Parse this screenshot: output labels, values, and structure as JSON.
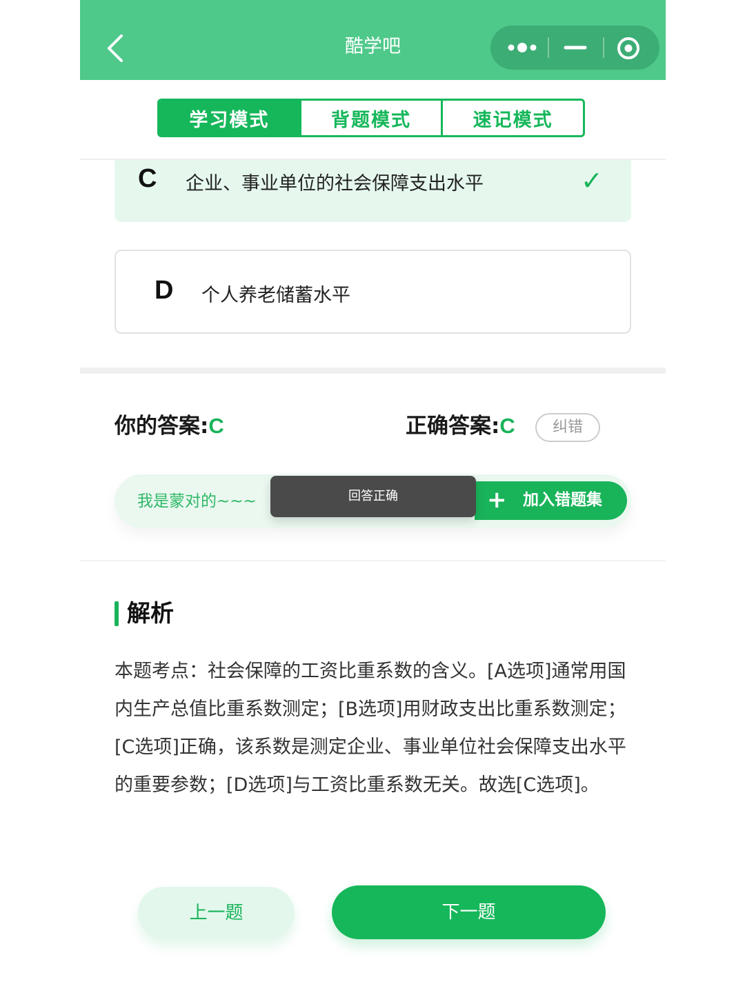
{
  "navbar": {
    "title": "酷学吧",
    "back_icon": "chevron-left-icon",
    "more_icon": "more-dots-icon",
    "minimize_icon": "minimize-icon",
    "close_icon": "target-close-icon"
  },
  "tabs": [
    {
      "label": "学习模式",
      "active": true
    },
    {
      "label": "背题模式",
      "active": false
    },
    {
      "label": "速记模式",
      "active": false
    }
  ],
  "options": {
    "c": {
      "letter": "C",
      "text": "企业、事业单位的社会保障支出水平",
      "mark": "✓"
    },
    "d": {
      "letter": "D",
      "text": "个人养老储蓄水平"
    }
  },
  "answer": {
    "your_label": "你的答案:",
    "your_value": "C",
    "correct_label": "正确答案:",
    "correct_value": "C",
    "report_label": "纠错"
  },
  "feedback": {
    "lucky_text": "我是蒙对的~~~",
    "toast": "回答正确",
    "add_plus": "+",
    "add_label": "加入错题集"
  },
  "analysis": {
    "title": "解析",
    "body": "本题考点：社会保障的工资比重系数的含义。[A选项]通常用国内生产总值比重系数测定；[B选项]用财政支出比重系数测定；[C选项]正确，该系数是测定企业、事业单位社会保障支出水平的重要参数；[D选项]与工资比重系数无关。故选[C选项]。"
  },
  "bottom": {
    "prev_label": "上一题",
    "next_label": "下一题"
  },
  "colors": {
    "navbar": "#4ec98a",
    "brand": "#15b75a",
    "light_green": "#e6f8ee"
  }
}
